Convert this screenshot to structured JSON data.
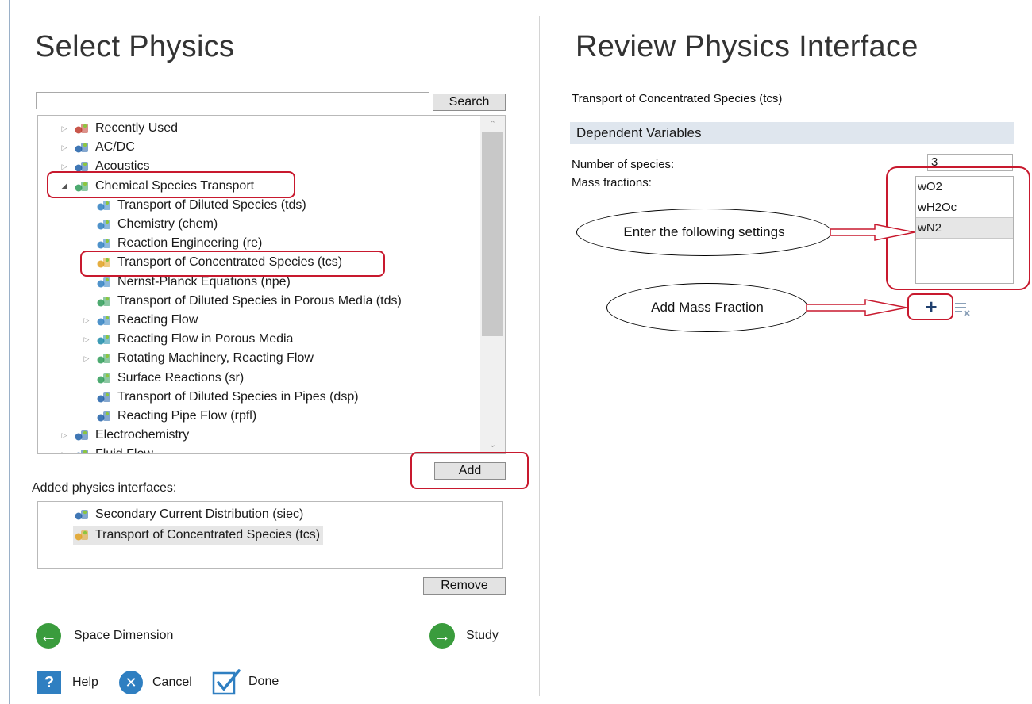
{
  "left": {
    "title": "Select Physics",
    "search": {
      "value": "",
      "button_label": "Search"
    },
    "tree": [
      {
        "label": "Recently Used",
        "icon": "clock-icon",
        "expander": "collapsed",
        "level": 0
      },
      {
        "label": "AC/DC",
        "icon": "lightning-icon",
        "expander": "collapsed",
        "level": 0
      },
      {
        "label": "Acoustics",
        "icon": "sound-waves-icon",
        "expander": "collapsed",
        "level": 0
      },
      {
        "label": "Chemical Species Transport",
        "icon": "molecules-icon",
        "expander": "expanded",
        "level": 0
      },
      {
        "label": "Transport of Diluted Species (tds)",
        "icon": "diluted-species-icon",
        "level": 1
      },
      {
        "label": "Chemistry (chem)",
        "icon": "chemistry-icon",
        "level": 1
      },
      {
        "label": "Reaction Engineering (re)",
        "icon": "flask-icon",
        "level": 1
      },
      {
        "label": "Transport of Concentrated Species (tcs)",
        "icon": "bottles-icon",
        "level": 1
      },
      {
        "label": "Nernst-Planck Equations (npe)",
        "icon": "nernst-planck-icon",
        "level": 1
      },
      {
        "label": "Transport of Diluted Species in Porous Media (tds)",
        "icon": "porous-media-icon",
        "level": 1
      },
      {
        "label": "Reacting Flow",
        "icon": "reacting-flow-icon",
        "expander": "collapsed",
        "level": 1
      },
      {
        "label": "Reacting Flow in Porous Media",
        "icon": "porous-flow-icon",
        "expander": "collapsed",
        "level": 1
      },
      {
        "label": "Rotating Machinery, Reacting Flow",
        "icon": "rotating-machinery-icon",
        "expander": "collapsed",
        "level": 1
      },
      {
        "label": "Surface Reactions (sr)",
        "icon": "surface-reactions-icon",
        "level": 1
      },
      {
        "label": "Transport of Diluted Species in Pipes (dsp)",
        "icon": "pipes-icon",
        "level": 1
      },
      {
        "label": "Reacting Pipe Flow (rpfl)",
        "icon": "pipe-flow-icon",
        "level": 1
      },
      {
        "label": "Electrochemistry",
        "icon": "electrochemistry-icon",
        "expander": "collapsed",
        "level": 0
      },
      {
        "label": "Fluid Flow",
        "icon": "fluid-flow-icon",
        "expander": "collapsed",
        "level": 0
      }
    ],
    "add_button": "Add",
    "added_label": "Added physics interfaces:",
    "added": [
      {
        "label": "Secondary Current Distribution (siec)",
        "icon": "current-distribution-icon",
        "selected": false
      },
      {
        "label": "Transport of Concentrated Species (tcs)",
        "icon": "bottles-icon",
        "selected": true
      }
    ],
    "remove_button": "Remove",
    "back_label": "Space Dimension",
    "next_label": "Study",
    "footer": {
      "help": "Help",
      "cancel": "Cancel",
      "done": "Done"
    }
  },
  "right": {
    "title": "Review Physics Interface",
    "interface_name": "Transport of Concentrated Species (tcs)",
    "section_title": "Dependent Variables",
    "num_species_label": "Number of species:",
    "num_species_value": "3",
    "mass_fractions_label": "Mass fractions:",
    "mass_fractions": [
      "wO2",
      "wH2Oc",
      "wN2"
    ],
    "callout_settings": "Enter the following settings",
    "callout_add": "Add Mass Fraction"
  },
  "colors": {
    "annotation": "#c8192e",
    "accent_blue": "#1f5fa8",
    "nav_green": "#3a9c3d",
    "section_bg": "#dfe6ee"
  }
}
